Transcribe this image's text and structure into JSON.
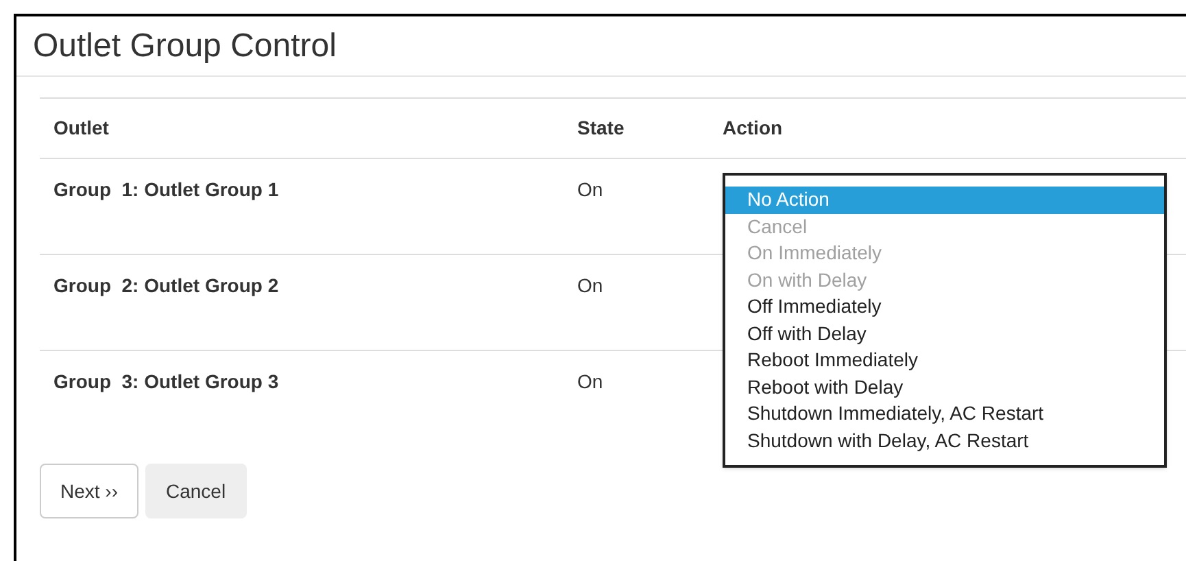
{
  "title": "Outlet Group Control",
  "table": {
    "columns": [
      "Outlet",
      "State",
      "Action"
    ],
    "rows": [
      {
        "outlet": "Group  1: Outlet Group 1",
        "state": "On"
      },
      {
        "outlet": "Group  2: Outlet Group 2",
        "state": "On"
      },
      {
        "outlet": "Group  3: Outlet Group 3",
        "state": "On"
      }
    ]
  },
  "action_dropdown": {
    "options": [
      {
        "label": "No Action",
        "selected": true,
        "disabled": false
      },
      {
        "label": "Cancel",
        "selected": false,
        "disabled": true
      },
      {
        "label": "On Immediately",
        "selected": false,
        "disabled": true
      },
      {
        "label": "On with Delay",
        "selected": false,
        "disabled": true
      },
      {
        "label": "Off Immediately",
        "selected": false,
        "disabled": false
      },
      {
        "label": "Off with Delay",
        "selected": false,
        "disabled": false
      },
      {
        "label": "Reboot Immediately",
        "selected": false,
        "disabled": false
      },
      {
        "label": "Reboot with Delay",
        "selected": false,
        "disabled": false
      },
      {
        "label": "Shutdown Immediately, AC Restart",
        "selected": false,
        "disabled": false
      },
      {
        "label": "Shutdown with Delay, AC Restart",
        "selected": false,
        "disabled": false
      }
    ]
  },
  "buttons": [
    {
      "label": "Next ››",
      "kind": "default"
    },
    {
      "label": "Cancel",
      "kind": "muted"
    }
  ]
}
